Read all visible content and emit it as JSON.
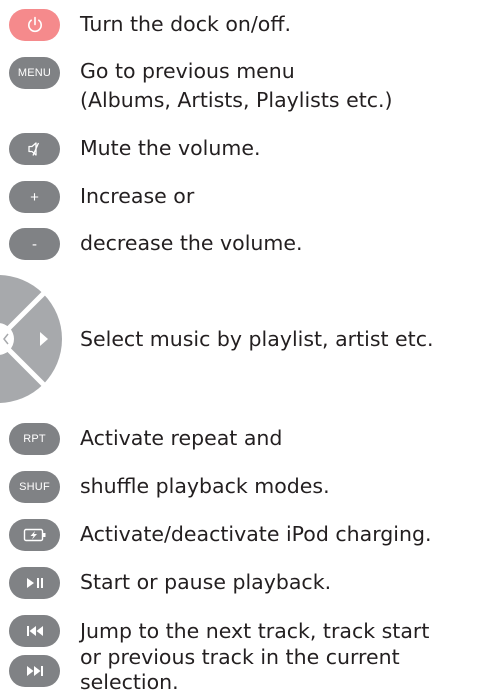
{
  "buttons": {
    "menu": "MENU",
    "plus": "+",
    "minus": "-",
    "rpt": "RPT",
    "shuf": "SHUF"
  },
  "descriptions": {
    "power": "Turn the dock on/off.",
    "menu_line1": "Go to previous menu",
    "menu_line2": "(Albums, Artists, Playlists etc.)",
    "mute": "Mute the volume.",
    "increase": "Increase or",
    "decrease": "decrease the volume.",
    "select": "Select music by playlist, artist etc.",
    "repeat": "Activate repeat and",
    "shuffle": "shuffle playback modes.",
    "charging": "Activate/deactivate iPod charging.",
    "play_pause": "Start or pause playback.",
    "jump_line1": "Jump to the next track, track start",
    "jump_line2": "or previous track in the current",
    "jump_line3": "selection."
  },
  "colors": {
    "button_gray": "#808285",
    "power_button": "#f58a8c",
    "dpad_gray": "#a7a9ac",
    "text": "#231f20"
  }
}
